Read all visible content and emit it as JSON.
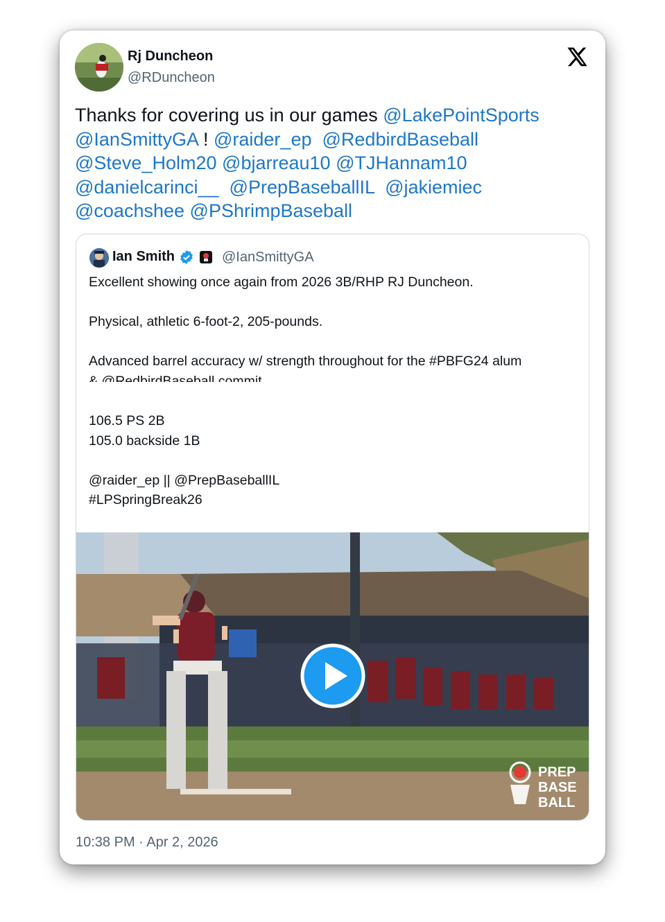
{
  "tweet": {
    "author": {
      "name": "Rj Duncheon",
      "handle": "@RDuncheon"
    },
    "text_segments": [
      {
        "type": "text",
        "value": "Thanks for covering us in our games "
      },
      {
        "type": "mention",
        "value": "@LakePointSports"
      },
      {
        "type": "text",
        "value": " "
      },
      {
        "type": "mention",
        "value": "@IanSmittyGA"
      },
      {
        "type": "text",
        "value": " ! "
      },
      {
        "type": "mention",
        "value": "@raider_ep"
      },
      {
        "type": "text",
        "value": "  "
      },
      {
        "type": "mention",
        "value": "@RedbirdBaseball"
      },
      {
        "type": "text",
        "value": " "
      },
      {
        "type": "mention",
        "value": "@Steve_Holm20"
      },
      {
        "type": "text",
        "value": " "
      },
      {
        "type": "mention",
        "value": "@bjarreau10"
      },
      {
        "type": "text",
        "value": " "
      },
      {
        "type": "mention",
        "value": "@TJHannam10"
      },
      {
        "type": "text",
        "value": " "
      },
      {
        "type": "mention",
        "value": "@danielcarinci__"
      },
      {
        "type": "text",
        "value": "  "
      },
      {
        "type": "mention",
        "value": "@PrepBaseballIL"
      },
      {
        "type": "text",
        "value": "  "
      },
      {
        "type": "mention",
        "value": "@jakiemiec"
      },
      {
        "type": "text",
        "value": " "
      },
      {
        "type": "mention",
        "value": "@coachshee"
      },
      {
        "type": "text",
        "value": " "
      },
      {
        "type": "mention",
        "value": "@PShrimpBaseball"
      }
    ],
    "timestamp": "10:38 PM · Apr 2, 2026",
    "mention_color": "#1d77c9"
  },
  "quote": {
    "author": {
      "name": "Ian Smith",
      "handle": "@IanSmittyGA",
      "verified": true
    },
    "lines": {
      "l1": "Excellent showing once again from 2026 3B/RHP RJ Duncheon.",
      "l2": "Physical, athletic 6-foot-2, 205-pounds.",
      "l3": "Advanced barrel accuracy w/ strength throughout for the #PBFG24 alum",
      "l4": "& @RedbirdBaseball commit.",
      "l5": "106.5 PS 2B",
      "l6": "105.0 backside 1B",
      "l7": "@raider_ep || @PrepBaseballIL",
      "l8": "#LPSpringBreak26"
    },
    "media": {
      "kind": "video",
      "play_icon": "play-icon",
      "watermark_lines": [
        "PREP",
        "BASE",
        "BALL"
      ]
    }
  },
  "icons": {
    "close": "x-logo-icon",
    "verified": "verified-badge-icon"
  }
}
